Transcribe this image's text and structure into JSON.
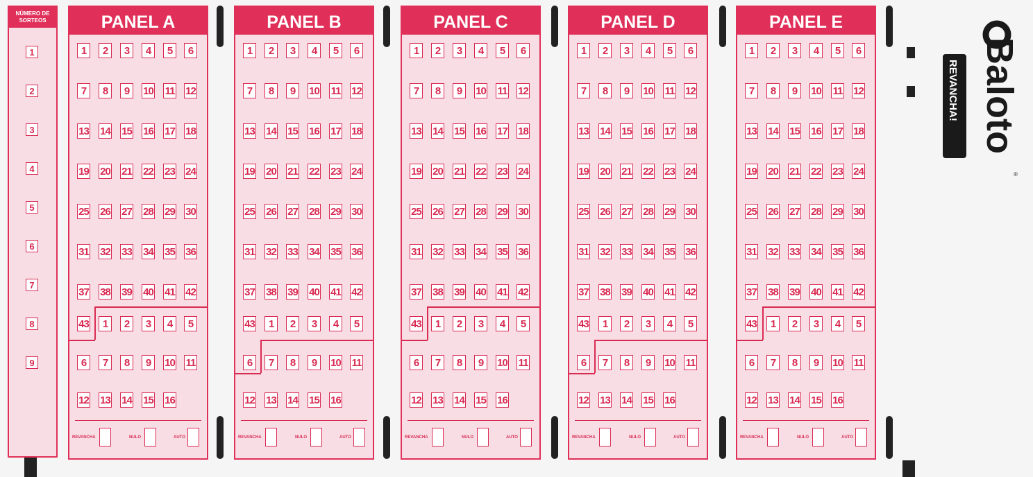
{
  "sorteos": {
    "title": "NÚMERO DE SORTEOS",
    "numbers": [
      "1",
      "2",
      "3",
      "4",
      "5",
      "6",
      "7",
      "8",
      "9"
    ]
  },
  "panels": [
    {
      "label": "PANEL A"
    },
    {
      "label": "PANEL B"
    },
    {
      "label": "PANEL C"
    },
    {
      "label": "PANEL D"
    },
    {
      "label": "PANEL E"
    }
  ],
  "main_numbers": [
    "1",
    "2",
    "3",
    "4",
    "5",
    "6",
    "7",
    "8",
    "9",
    "10",
    "11",
    "12",
    "13",
    "14",
    "15",
    "16",
    "17",
    "18",
    "19",
    "20",
    "21",
    "22",
    "23",
    "24",
    "25",
    "26",
    "27",
    "28",
    "29",
    "30",
    "31",
    "32",
    "33",
    "34",
    "35",
    "36",
    "37",
    "38",
    "39",
    "40",
    "41",
    "42",
    "43"
  ],
  "super_numbers": [
    "1",
    "2",
    "3",
    "4",
    "5",
    "6",
    "7",
    "8",
    "9",
    "10",
    "11",
    "12",
    "13",
    "14",
    "15",
    "16"
  ],
  "options": {
    "revancha": "REVANCHA",
    "nulo": "NULO",
    "auto": "AUTO"
  },
  "logo": {
    "brand": "Baloto",
    "sub": "REVANCHA!",
    "registered": "®",
    "colors": {
      "mark": "#1a1a1a",
      "accent": "#e0305a"
    }
  },
  "colors": {
    "accent": "#e0305a",
    "panel_bg": "#f8dde5"
  }
}
